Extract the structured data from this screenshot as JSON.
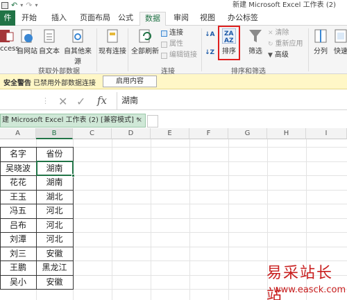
{
  "title": "新建 Microsoft Excel 工作表 (2)",
  "tabs": [
    "件",
    "开始",
    "插入",
    "页面布局",
    "公式",
    "数据",
    "审阅",
    "视图",
    "办公标签"
  ],
  "ribbon": {
    "get_external": {
      "buttons": [
        "ccess",
        "自网站",
        "自文本",
        "自其他来源",
        "现有连接"
      ],
      "group_label": "获取外部数据"
    },
    "connections": {
      "refresh_all": "全部刷新",
      "small": [
        "连接",
        "属性",
        "编辑链接"
      ],
      "group_label": "连接"
    },
    "sort_filter": {
      "sort": "排序",
      "filter": "筛选",
      "small": [
        "清除",
        "重新应用",
        "高级"
      ],
      "group_label": "排序和筛选"
    },
    "data_tools": {
      "split": "分列",
      "quick": "快速"
    }
  },
  "security_bar": {
    "label": "安全警告",
    "message": "已禁用外部数据连接",
    "button": "启用内容"
  },
  "formula_bar": {
    "value": "湖南"
  },
  "workbook_tab": {
    "label": "建 Microsoft Excel 工作表 (2)  [兼容模式] *",
    "close": "×"
  },
  "columns": [
    "A",
    "B",
    "C",
    "D",
    "E",
    "F",
    "G",
    "H",
    "I"
  ],
  "table": {
    "headers": [
      "名字",
      "省份"
    ],
    "rows": [
      [
        "吴晓波",
        "湖南"
      ],
      [
        "花花",
        "湖南"
      ],
      [
        "王玉",
        "湖北"
      ],
      [
        "冯五",
        "河北"
      ],
      [
        "吕布",
        "河北"
      ],
      [
        "刘潭",
        "河北"
      ],
      [
        "刘三",
        "安徽"
      ],
      [
        "王鹏",
        "黑龙江"
      ],
      [
        "吴小",
        "安徽"
      ]
    ]
  },
  "watermark": {
    "line1": "易采站长站",
    "line2": "www.easck.com"
  },
  "colors": {
    "accent": "#217346",
    "security_bg": "#fff7c7",
    "watermark": "#c81e1e",
    "highlight": "#e02020"
  }
}
